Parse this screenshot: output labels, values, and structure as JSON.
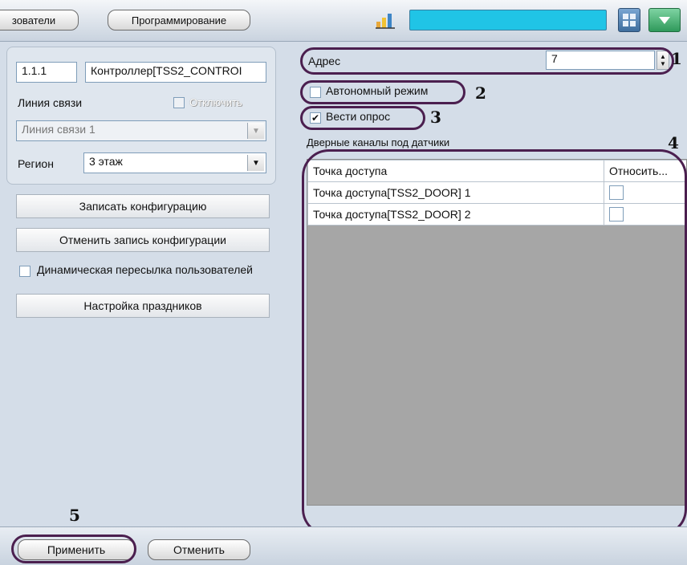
{
  "toolbar": {
    "users_tab_label": "зователи",
    "programming_tab_label": "Программирование"
  },
  "left": {
    "id_value": "1.1.1",
    "name_value": "Контроллер[TSS2_CONTROI",
    "line_label": "Линия связи",
    "disconnect_label": "Отключить",
    "line_select_value": "Линия связи 1",
    "region_label": "Регион",
    "region_value": "3 этаж",
    "write_config_label": "Записать конфигурацию",
    "cancel_write_label": "Отменить запись конфигурации",
    "dynamic_sync_label": "Динамическая пересылка пользователей",
    "holidays_label": "Настройка праздников"
  },
  "right": {
    "address_label": "Адрес",
    "address_value": "7",
    "autonomous_label": "Автономный режим",
    "polling_label": "Вести опрос",
    "door_channels_label": "Дверные каналы под датчики",
    "table": {
      "headers": [
        "Точка доступа",
        "Относить..."
      ],
      "rows": [
        {
          "name": "Точка доступа[TSS2_DOOR] 1"
        },
        {
          "name": "Точка доступа[TSS2_DOOR] 2"
        }
      ]
    }
  },
  "bottom": {
    "apply_label": "Применить",
    "cancel_label": "Отменить"
  },
  "callouts": {
    "n1": "1",
    "n2": "2",
    "n3": "3",
    "n4": "4",
    "n5": "5"
  },
  "colors": {
    "accent_field": "#20c4e6",
    "oval": "#4b1f4f",
    "grid_bg": "#a6a6a6"
  },
  "states": {
    "autonomous_checked": false,
    "polling_checked": true,
    "dynamic_sync_checked": false,
    "disconnect_checked": false
  }
}
